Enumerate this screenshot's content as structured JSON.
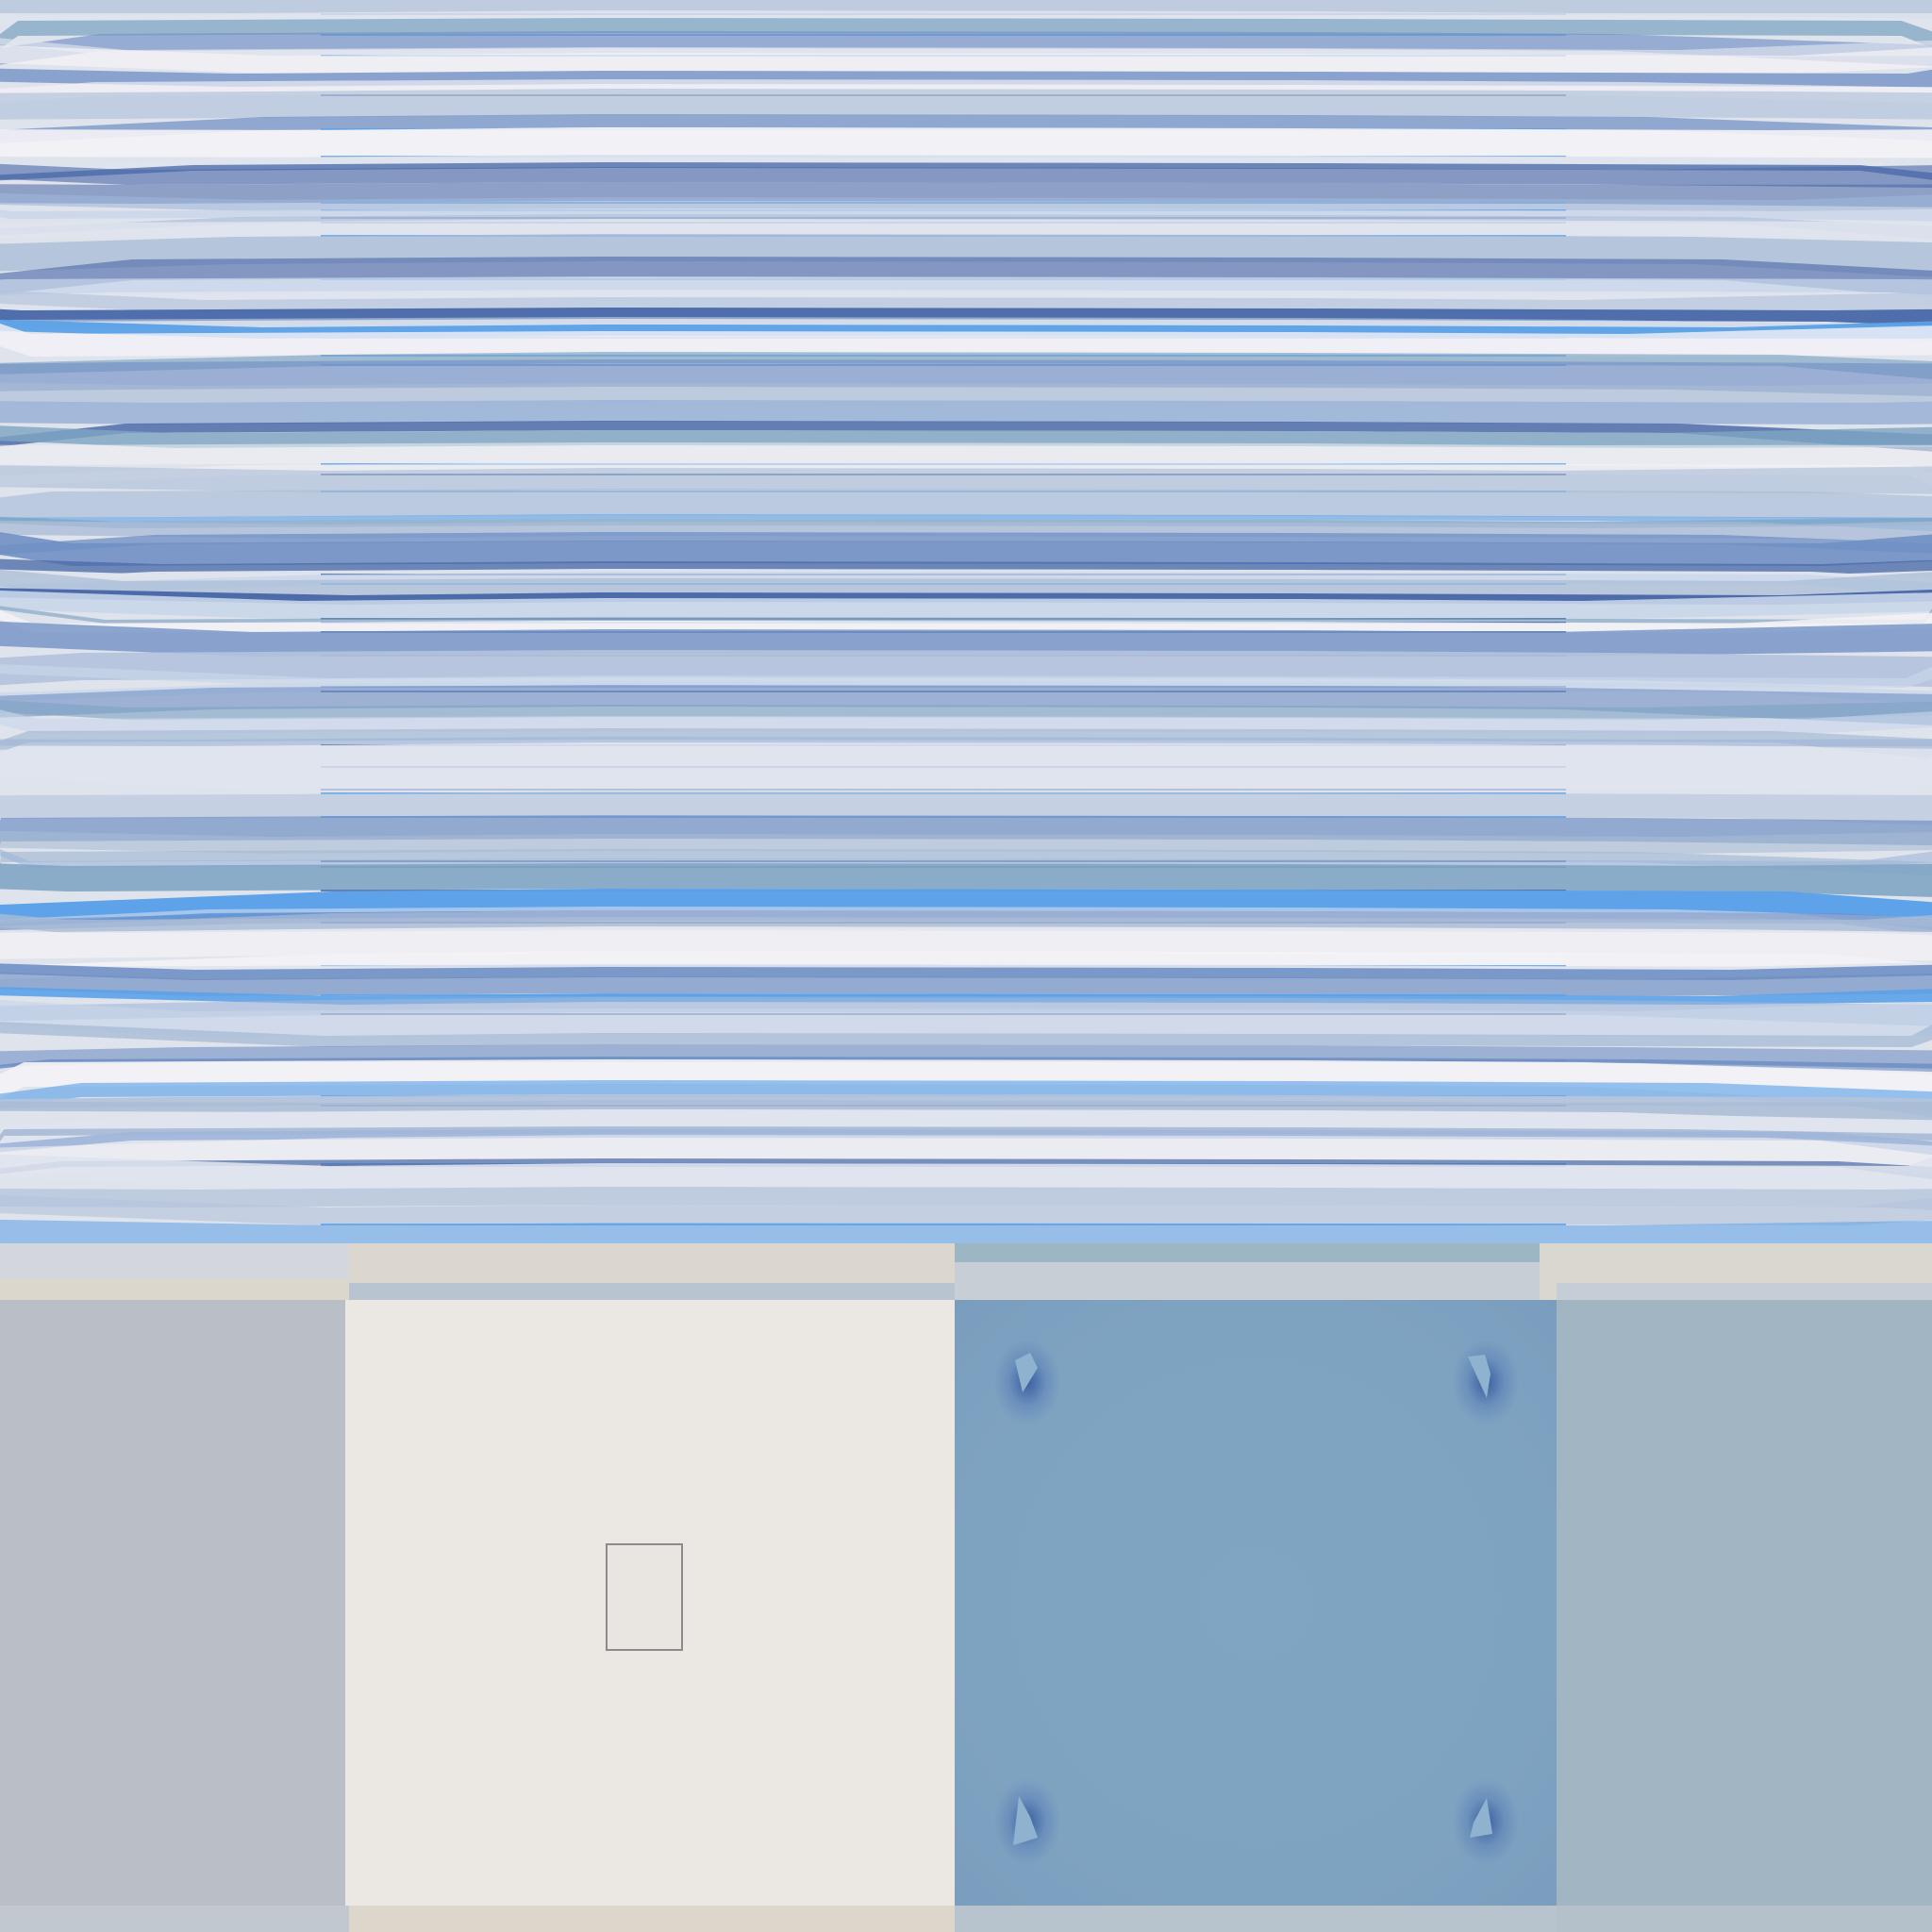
{
  "palette": {
    "deep": "#4a69a8",
    "mid": "#7fa5c3",
    "bright": "#5aa0e8",
    "pale": "#c8d6ea",
    "white": "#f3f2f6",
    "stone": "#dcd7ce"
  },
  "regions": {
    "panel_left_color": "#b9bec7",
    "panel_light_color": "#ebe8e4",
    "panel_blue_color": "#7fa5c3",
    "panel_right_color": "#a2b5c3"
  }
}
